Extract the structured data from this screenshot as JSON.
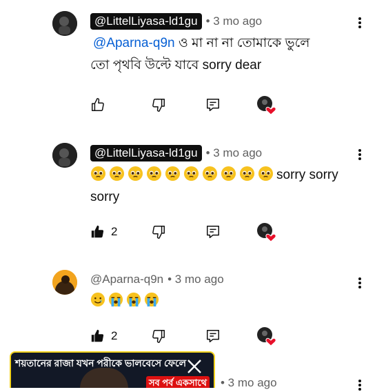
{
  "comments": [
    {
      "author": "@LittelLiyasa-ld1gu",
      "time": "• 3 mo ago",
      "mention": "@Aparna-q9n",
      "text_line1": " ও মা না না তোমাকে ভুলে",
      "text_line2": "তো পৃথবি উল্টে যাবে sorry dear",
      "likes": ""
    },
    {
      "author": "@LittelLiyasa-ld1gu",
      "time": "• 3 mo ago",
      "text_line1": "sorry sorry",
      "text_line2": "sorry",
      "emoji": "pleading-face-emoji",
      "emoji_count": 10,
      "likes": "2"
    },
    {
      "author": "@Aparna-q9n",
      "time": "• 3 mo ago",
      "emojis": [
        "smiling-with-tear-emoji",
        "crying-emoji",
        "crying-emoji",
        "crying-emoji"
      ],
      "likes": "2"
    },
    {
      "time": "• 3 mo ago"
    }
  ],
  "promo": {
    "title": "শয়তানের রাজা যখন পরীকে ভালবেসে ফেলে",
    "subtitle": "সব পর্ব একসাথে",
    "close_icon": "close-icon"
  },
  "colors": {
    "heart": "#e8102a",
    "mention": "#065fd4",
    "promo_border": "#f2d21b"
  }
}
